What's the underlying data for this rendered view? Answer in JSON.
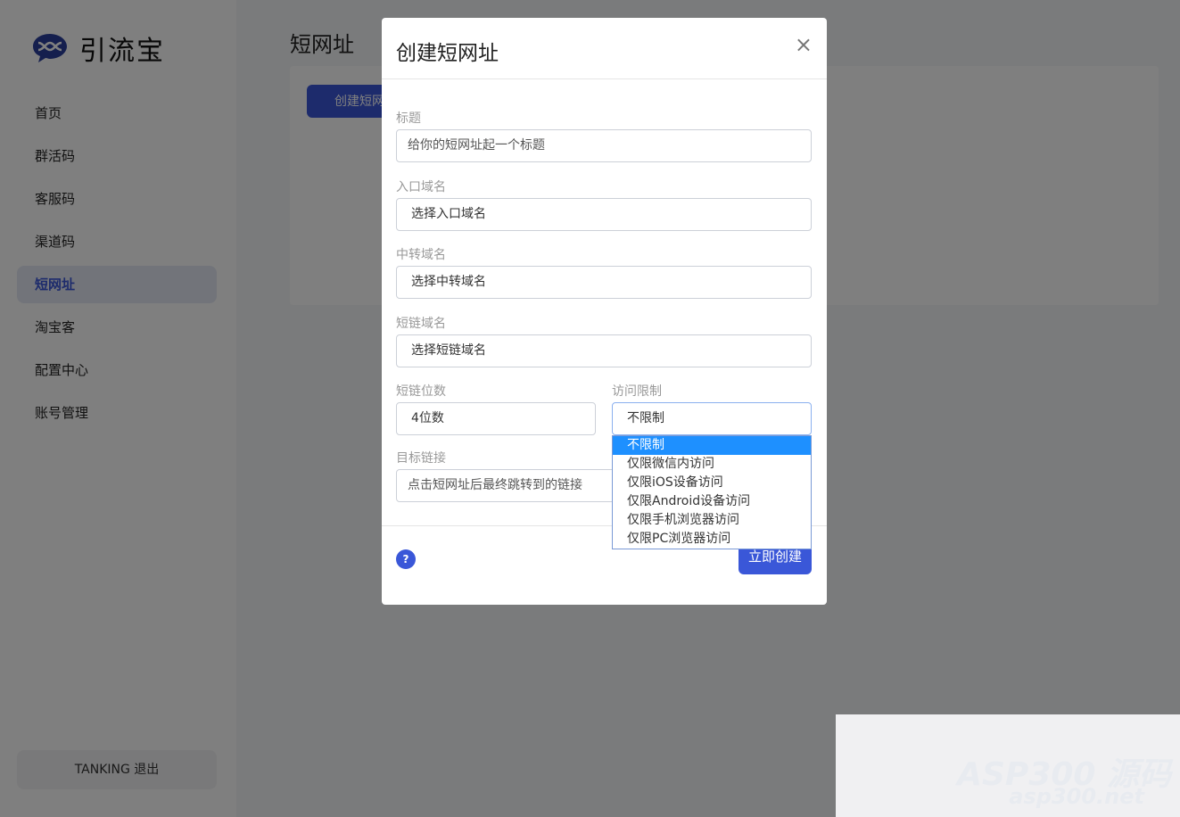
{
  "app": {
    "name": "引流宝",
    "logo_icon": "chat-bubble-logo"
  },
  "sidebar": {
    "items": [
      {
        "label": "首页"
      },
      {
        "label": "群活码"
      },
      {
        "label": "客服码"
      },
      {
        "label": "渠道码"
      },
      {
        "label": "短网址",
        "active": true
      },
      {
        "label": "淘宝客"
      },
      {
        "label": "配置中心"
      },
      {
        "label": "账号管理"
      }
    ],
    "logout": "TANKING  退出"
  },
  "main": {
    "title": "短网址",
    "create_button": "创建短网址"
  },
  "modal": {
    "title": "创建短网址",
    "close": "×",
    "fields": {
      "title": {
        "label": "标题",
        "placeholder": "给你的短网址起一个标题"
      },
      "entry_domain": {
        "label": "入口域名",
        "value": "选择入口域名"
      },
      "transit_domain": {
        "label": "中转域名",
        "value": "选择中转域名"
      },
      "short_domain": {
        "label": "短链域名",
        "value": "选择短链域名"
      },
      "length": {
        "label": "短链位数",
        "value": "4位数"
      },
      "access": {
        "label": "访问限制",
        "value": "不限制",
        "options": [
          "不限制",
          "仅限微信内访问",
          "仅限iOS设备访问",
          "仅限Android设备访问",
          "仅限手机浏览器访问",
          "仅限PC浏览器访问"
        ]
      },
      "target": {
        "label": "目标链接",
        "placeholder": "点击短网址后最终跳转到的链接"
      }
    },
    "help": "?",
    "submit": "立即创建"
  },
  "watermark": {
    "line1": "ASP300 源码",
    "line2": "asp300.net"
  },
  "colors": {
    "accent": "#3a57d8",
    "selected_option": "#1e90ff"
  }
}
